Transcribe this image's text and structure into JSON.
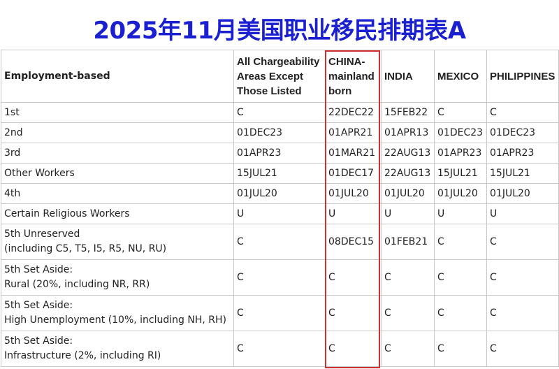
{
  "title": "2025年11月美国职业移民排期表A",
  "table": {
    "headers": [
      "Employment-based",
      "All Chargeability Areas Except Those Listed",
      "CHINA-mainland born",
      "INDIA",
      "MEXICO",
      "PHILIPPINES"
    ],
    "rows": [
      {
        "cat": [
          "1st"
        ],
        "vals": [
          "C",
          "22DEC22",
          "15FEB22",
          "C",
          "C"
        ]
      },
      {
        "cat": [
          "2nd"
        ],
        "vals": [
          "01DEC23",
          "01APR21",
          "01APR13",
          "01DEC23",
          "01DEC23"
        ]
      },
      {
        "cat": [
          "3rd"
        ],
        "vals": [
          "01APR23",
          "01MAR21",
          "22AUG13",
          "01APR23",
          "01APR23"
        ]
      },
      {
        "cat": [
          "Other Workers"
        ],
        "vals": [
          "15JUL21",
          "01DEC17",
          "22AUG13",
          "15JUL21",
          "15JUL21"
        ]
      },
      {
        "cat": [
          "4th"
        ],
        "vals": [
          "01JUL20",
          "01JUL20",
          "01JUL20",
          "01JUL20",
          "01JUL20"
        ]
      },
      {
        "cat": [
          "Certain Religious Workers"
        ],
        "vals": [
          "U",
          "U",
          "U",
          "U",
          "U"
        ]
      },
      {
        "cat": [
          "5th Unreserved",
          "(including C5, T5, I5, R5, NU, RU)"
        ],
        "vals": [
          "C",
          "08DEC15",
          "01FEB21",
          "C",
          "C"
        ]
      },
      {
        "cat": [
          "5th Set Aside:",
          "Rural (20%, including NR, RR)"
        ],
        "vals": [
          "C",
          "C",
          "C",
          "C",
          "C"
        ]
      },
      {
        "cat": [
          "5th Set Aside:",
          "High Unemployment (10%, including NH, RH)"
        ],
        "vals": [
          "C",
          "C",
          "C",
          "C",
          "C"
        ]
      },
      {
        "cat": [
          "5th Set Aside:",
          "Infrastructure (2%, including RI)"
        ],
        "vals": [
          "C",
          "C",
          "C",
          "C",
          "C"
        ]
      }
    ]
  },
  "colors": {
    "title": "#1a1fd0",
    "grid": "#c8c8c8",
    "highlight": "#d03030"
  }
}
